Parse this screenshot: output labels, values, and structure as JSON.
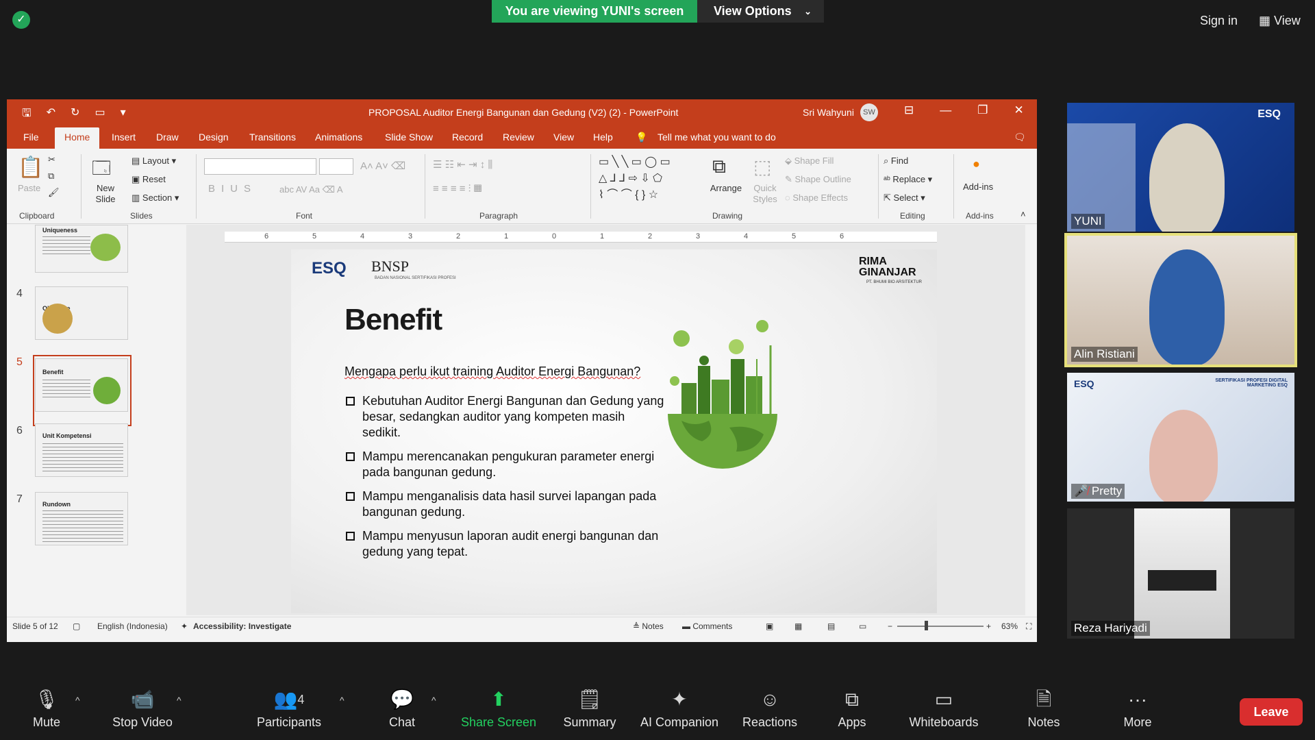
{
  "zoom_meeting": {
    "viewing_banner": "You are viewing YUNI's screen",
    "view_options": "View Options",
    "sign_in": "Sign in",
    "view": "View"
  },
  "powerpoint": {
    "doc_title": "PROPOSAL Auditor Energi Bangunan dan Gedung (V2) (2)  -  PowerPoint",
    "user_name": "Sri Wahyuni",
    "user_initials": "SW",
    "tabs": [
      "File",
      "Home",
      "Insert",
      "Draw",
      "Design",
      "Transitions",
      "Animations",
      "Slide Show",
      "Record",
      "Review",
      "View",
      "Help"
    ],
    "tell_me": "Tell me what you want to do",
    "ribbon": {
      "paste": "Paste",
      "new_slide": "New Slide",
      "layout": "Layout",
      "reset": "Reset",
      "section": "Section",
      "arrange": "Arrange",
      "quick_styles": "Quick Styles",
      "shape_fill": "Shape Fill",
      "shape_outline": "Shape Outline",
      "shape_effects": "Shape Effects",
      "find": "Find",
      "replace": "Replace",
      "select": "Select",
      "add_ins": "Add-ins",
      "groups": {
        "clipboard": "Clipboard",
        "slides": "Slides",
        "font": "Font",
        "paragraph": "Paragraph",
        "drawing": "Drawing",
        "editing": "Editing",
        "addins": "Add-ins"
      }
    },
    "thumbnails": [
      {
        "num": "",
        "title": "Uniqueness"
      },
      {
        "num": "4",
        "title": "Objective"
      },
      {
        "num": "5",
        "title": "Benefit"
      },
      {
        "num": "6",
        "title": "Unit Kompetensi"
      },
      {
        "num": "7",
        "title": "Rundown"
      }
    ],
    "ruler_labels": [
      "6",
      "5",
      "4",
      "3",
      "2",
      "1",
      "0",
      "1",
      "2",
      "3",
      "4",
      "5",
      "6"
    ],
    "slide": {
      "logo_esq": "ESQ",
      "logo_bnsp": "BNSP",
      "logo_bnsp_sub": "BADAN NASIONAL SERTIFIKASI PROFESI",
      "logo_rima": "RIMA GINANJAR",
      "logo_rima_sub": "PT. BHUMI BIO ARSITEKTUR",
      "title": "Benefit",
      "question": "Mengapa perlu ikut training Auditor Energi Bangunan?",
      "bullets": [
        "Kebutuhan Auditor Energi Bangunan dan Gedung yang besar, sedangkan auditor yang kompeten masih sedikit.",
        "Mampu merencanakan pengukuran parameter energi pada bangunan gedung.",
        "Mampu menganalisis data hasil survei lapangan pada bangunan gedung.",
        "Mampu menyusun laporan audit energi bangunan dan gedung yang tepat."
      ]
    },
    "status": {
      "slide_of": "Slide 5 of 12",
      "language": "English (Indonesia)",
      "accessibility": "Accessibility: Investigate",
      "notes": "Notes",
      "comments": "Comments",
      "zoom": "63%"
    }
  },
  "participants_gallery": [
    {
      "name": "YUNI"
    },
    {
      "name": "Alin Ristiani"
    },
    {
      "name": "Pretty"
    },
    {
      "name": "Reza Hariyadi"
    }
  ],
  "gallery_badges": {
    "esq": "ESQ",
    "sertifikasi": "SERTIFIKASI PROFESI DIGITAL MARKETING ESQ"
  },
  "toolbar": {
    "mute": "Mute",
    "stop_video": "Stop Video",
    "participants": "Participants",
    "participants_count": "4",
    "chat": "Chat",
    "share_screen": "Share Screen",
    "summary": "Summary",
    "ai_companion": "AI Companion",
    "reactions": "Reactions",
    "apps": "Apps",
    "whiteboards": "Whiteboards",
    "notes": "Notes",
    "more": "More",
    "leave": "Leave"
  },
  "colors": {
    "zoom_green": "#23a559",
    "ppt_accent": "#c43e1c",
    "leave_red": "#d92e2e",
    "active_speaker": "#e6e07a"
  }
}
